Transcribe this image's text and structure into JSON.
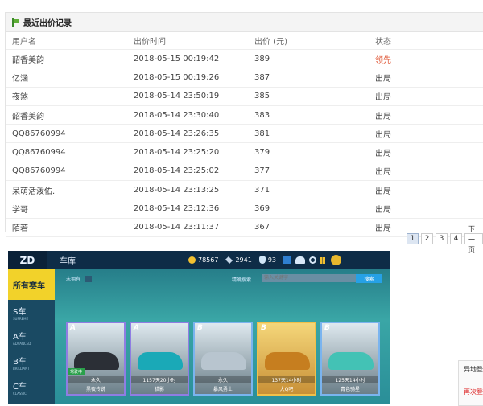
{
  "bid_records": {
    "title": "最近出价记录",
    "columns": [
      "用户名",
      "出价时间",
      "出价 (元)",
      "状态"
    ],
    "rows": [
      {
        "user": "韶香美韵",
        "time": "2018-05-15 00:19:42",
        "price": "389",
        "status": "领先"
      },
      {
        "user": "亿涵",
        "time": "2018-05-15 00:19:26",
        "price": "387",
        "status": "出局"
      },
      {
        "user": "夜煞",
        "time": "2018-05-14 23:50:19",
        "price": "385",
        "status": "出局"
      },
      {
        "user": "韶香美韵",
        "time": "2018-05-14 23:30:40",
        "price": "383",
        "status": "出局"
      },
      {
        "user": "QQ86760994",
        "time": "2018-05-14 23:26:35",
        "price": "381",
        "status": "出局"
      },
      {
        "user": "QQ86760994",
        "time": "2018-05-14 23:25:20",
        "price": "379",
        "status": "出局"
      },
      {
        "user": "QQ86760994",
        "time": "2018-05-14 23:25:02",
        "price": "377",
        "status": "出局"
      },
      {
        "user": "呆萌活泼佑.",
        "time": "2018-05-14 23:13:25",
        "price": "371",
        "status": "出局"
      },
      {
        "user": "学哥",
        "time": "2018-05-14 23:12:36",
        "price": "369",
        "status": "出局"
      },
      {
        "user": "陌若",
        "time": "2018-05-14 23:11:37",
        "price": "367",
        "status": "出局"
      }
    ],
    "colors": {
      "leading": "#e05a3a",
      "outbid": "#444444"
    }
  },
  "pagination": {
    "pages": [
      "1",
      "2",
      "3",
      "4"
    ],
    "active": "1",
    "next_label": "下一页"
  },
  "game": {
    "logo": "ZD",
    "title": "车库",
    "coins": "78567",
    "gems": "2941",
    "shields": "93",
    "sidebar": [
      {
        "label": "所有赛车",
        "sub": ""
      },
      {
        "label": "S车",
        "sub": "SUPREME"
      },
      {
        "label": "A车",
        "sub": "ADVANCED"
      },
      {
        "label": "B车",
        "sub": "BRILLIANT"
      },
      {
        "label": "C车",
        "sub": "CLASSIC"
      }
    ],
    "filter_label": "未拥有",
    "search_label": "精确搜索",
    "search_placeholder": "输入关键字",
    "search_button": "搜索",
    "cards": [
      {
        "rank": "A",
        "duration": "永久",
        "name": "黑夜传说",
        "driving": "驾驶中"
      },
      {
        "rank": "A",
        "duration": "1157天20小时",
        "name": "猎影",
        "driving": ""
      },
      {
        "rank": "B",
        "duration": "永久",
        "name": "暴风勇士",
        "driving": ""
      },
      {
        "rank": "B",
        "duration": "137天14小时",
        "name": "大Q吧",
        "driving": ""
      },
      {
        "rank": "B",
        "duration": "125天14小时",
        "name": "青色骑星",
        "driving": ""
      }
    ]
  },
  "side_box": {
    "title": "异地登",
    "alert": "再次登"
  }
}
